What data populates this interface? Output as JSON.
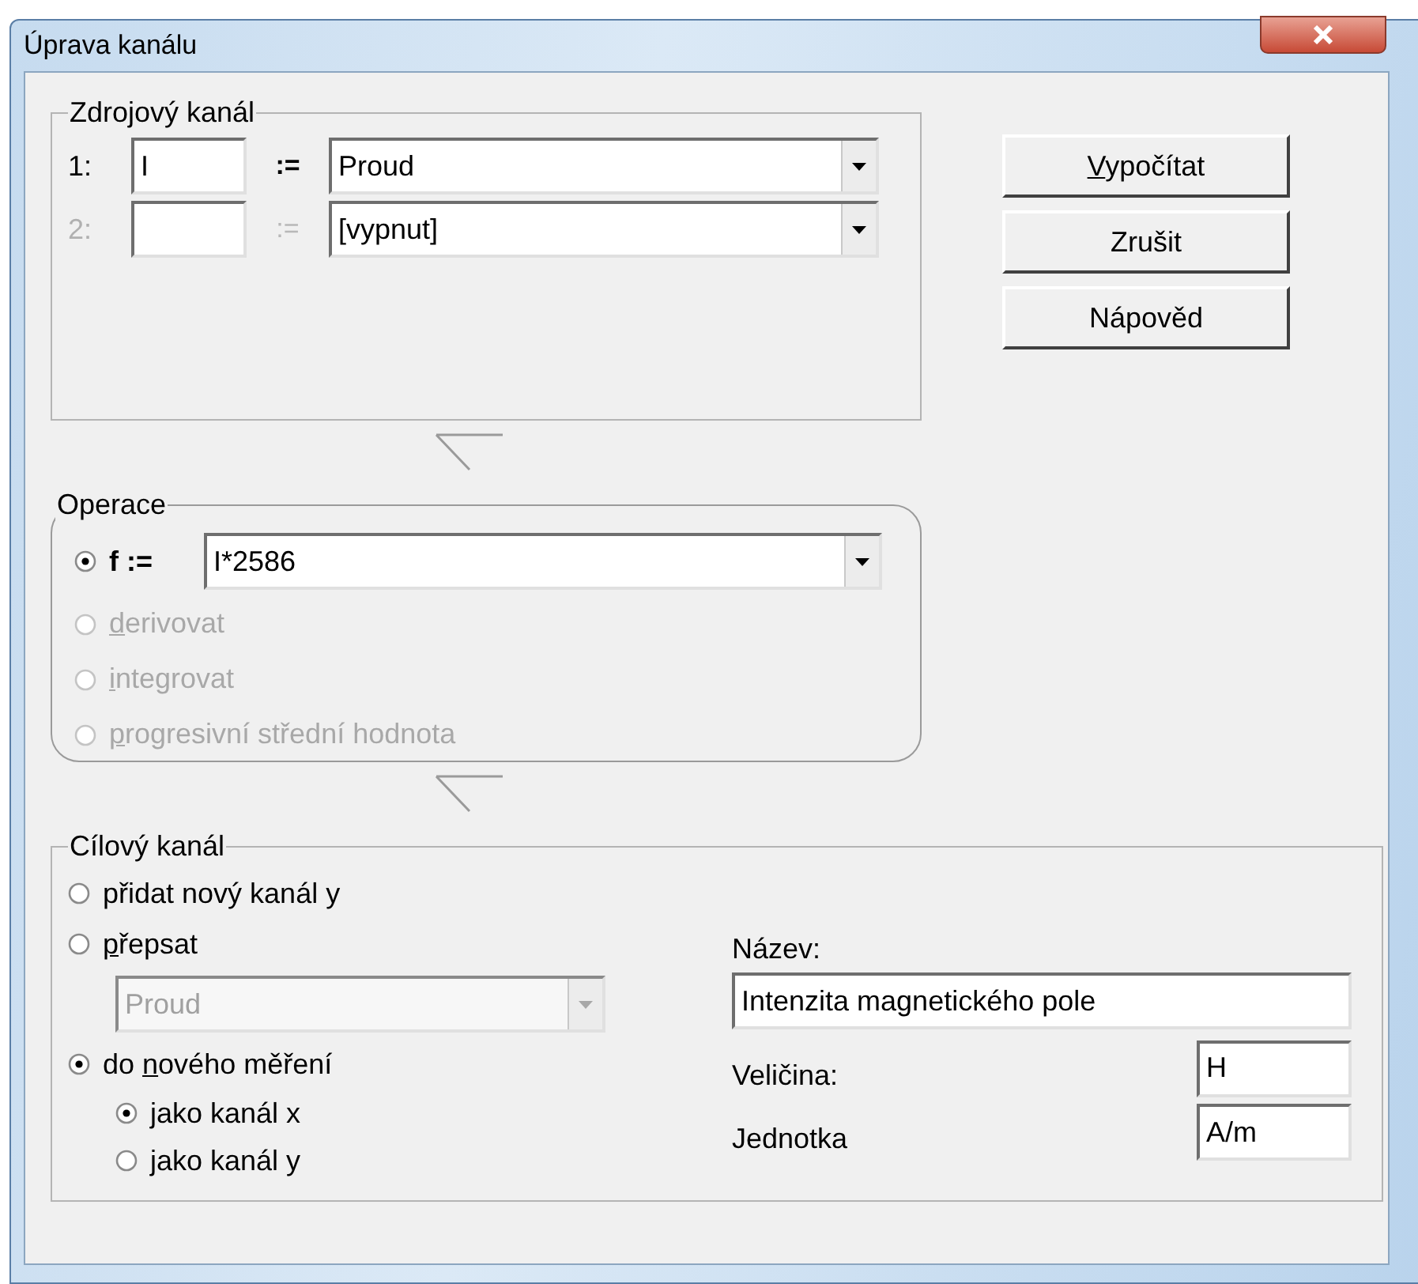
{
  "window": {
    "title": "Úprava kanálu"
  },
  "source": {
    "title": "Zdrojový kanál",
    "rows": [
      {
        "index": "1:",
        "name": "I",
        "assign": ":=",
        "channel": "Proud",
        "disabled": false
      },
      {
        "index": "2:",
        "assign": ":=",
        "channel": "[vypnut]",
        "disabled": true
      }
    ]
  },
  "buttons": [
    {
      "key": "V",
      "after": "ypočítat"
    },
    {
      "before": "Zrušit"
    },
    {
      "before": "Nápověd"
    }
  ],
  "operation": {
    "title": "Operace",
    "options": [
      {
        "kind": "formula",
        "label": "f :=",
        "value": "I*2586",
        "selected": true,
        "disabled": false
      },
      {
        "kind": "plain",
        "key": "d",
        "after": "erivovat",
        "selected": false,
        "disabled": true
      },
      {
        "kind": "plain",
        "key": "i",
        "after": "ntegrovat",
        "selected": false,
        "disabled": true
      },
      {
        "kind": "plain",
        "key": "p",
        "after": "rogresivní střední hodnota",
        "selected": false,
        "disabled": true
      }
    ]
  },
  "target": {
    "title": "Cílový kanál",
    "options": [
      {
        "before": "přidat nový kanál y",
        "selected": false
      },
      {
        "key": "p",
        "after": "řepsat",
        "selected": false,
        "combo": {
          "value": "Proud",
          "disabled": true
        }
      },
      {
        "before": "do ",
        "key": "n",
        "after": "ového měření",
        "selected": true,
        "children": [
          {
            "before": "jako kanál x",
            "selected": true
          },
          {
            "before": "jako kanál y",
            "selected": false
          }
        ]
      }
    ],
    "name_label": "Název:",
    "name_value": "Intenzita magnetického pole",
    "quantity_label": "Veličina:",
    "quantity_value": "H",
    "unit_label": "Jednotka",
    "unit_value": "A/m"
  }
}
